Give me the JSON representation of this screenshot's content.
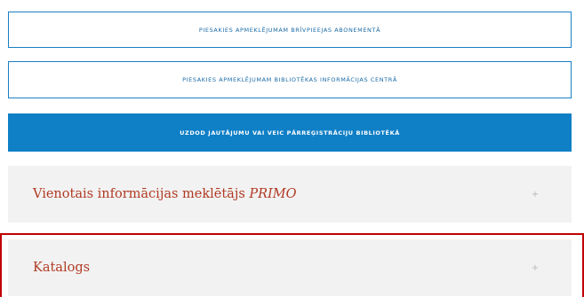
{
  "buttons": [
    {
      "label": "PIESAKIES APMEKLĒJUMAM BRĪVPIEEJAS ABONEMENTĀ"
    },
    {
      "label": "PIESAKIES APMEKLĒJUMAM BIBLIOTĒKAS INFORMĀCIJAS CENTRĀ"
    },
    {
      "label": "UZDOD JAUTĀJUMU VAI VEIC PĀRREĢISTRĀCIJU BIBLIOTĒKĀ"
    }
  ],
  "accordion": [
    {
      "label": "Vienotais informācijas meklētājs",
      "label_emphasis": "PRIMO",
      "toggle": "+"
    },
    {
      "label": "Katalogs",
      "toggle": "+"
    }
  ],
  "colors": {
    "accent_blue": "#0f7fc6",
    "title_red": "#b03a23",
    "panel_bg": "#f2f2f2",
    "highlight_border": "#c00000"
  }
}
